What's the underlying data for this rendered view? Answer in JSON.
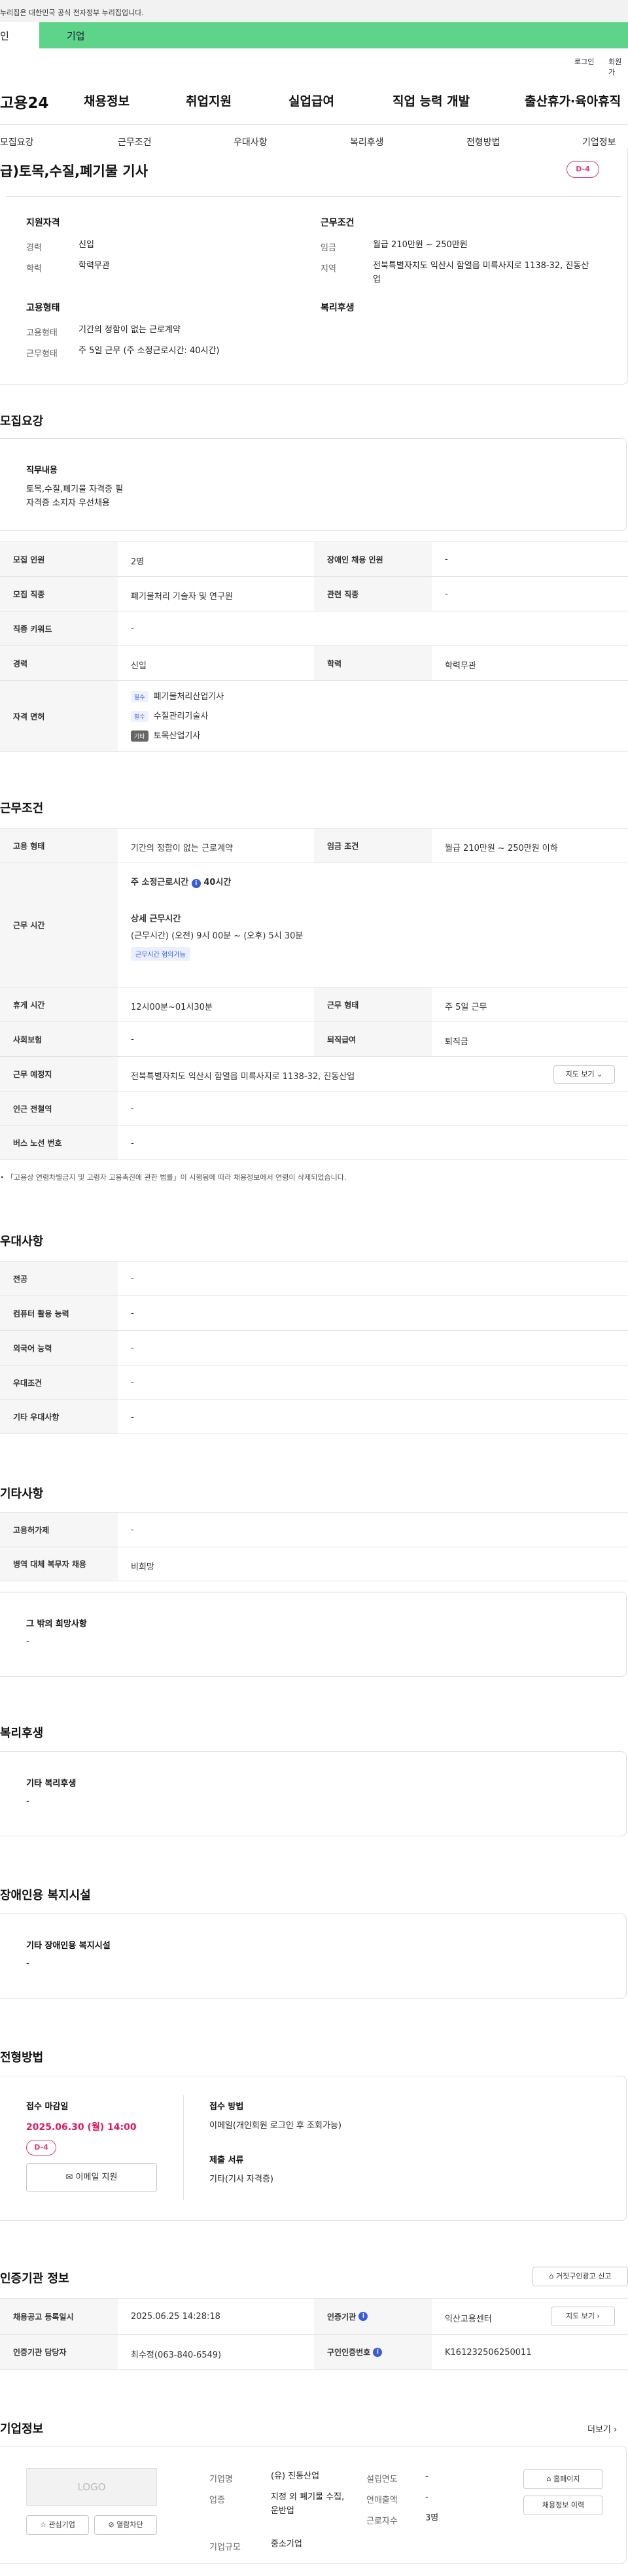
{
  "gov_bar": {
    "text": "누리집은 대한민국 공식 전자정부 누리집입니다."
  },
  "top_tabs": {
    "personal": "인",
    "company": "기업"
  },
  "util": {
    "login": "로그인",
    "signup": "회원가"
  },
  "header": {
    "logo": "고용24",
    "gnb": [
      "채용정보",
      "취업지원",
      "실업급여",
      "직업 능력 개발",
      "출산휴가·육아휴직"
    ]
  },
  "subnav": [
    "모집요강",
    "근무조건",
    "우대사항",
    "복리후생",
    "전형방법",
    "기업정보"
  ],
  "job_title": "급)토목,수질,폐기물 기사",
  "d_day": "D-4",
  "summary": {
    "qualification": {
      "heading": "지원자격",
      "career_label": "경력",
      "career": "신입",
      "edu_label": "학력",
      "edu": "학력무관"
    },
    "condition": {
      "heading": "근무조건",
      "wage_label": "임금",
      "wage": "월급 210만원 ~ 250만원",
      "loc_label": "지역",
      "loc": "전북특별자치도 익산시 함열읍 미륵사지로 1138-32, 진동산업"
    },
    "employment": {
      "heading": "고용형태",
      "type_label": "고용형태",
      "type": "기간의 정함이 없는 근로계약",
      "hours_label": "근무형태",
      "hours": "주 5일 근무 (주 소정근로시간: 40시간)"
    },
    "welfare": {
      "heading": "복리후생"
    }
  },
  "recruit": {
    "heading": "모집요강",
    "duty_label": "직무내용",
    "duty_lines": [
      "토목,수질,폐기물 자격증 필",
      "자격증 소지자 우선채용"
    ],
    "rows": {
      "count_label": "모집 인원",
      "count": "2명",
      "disabled_label": "장애인 채용 인원",
      "disabled": "-",
      "job_label": "모집 직종",
      "job": "폐기물처리 기술자 및 연구원",
      "related_label": "관련 직종",
      "related": "-",
      "keyword_label": "직종 키워드",
      "keyword": "-",
      "career_label": "경력",
      "career": "신입",
      "edu_label": "학력",
      "edu": "학력무관",
      "license_label": "자격 면허",
      "licenses": [
        {
          "badge": "필수",
          "name": "폐기물처리산업기사"
        },
        {
          "badge": "필수",
          "name": "수질관리기술사"
        },
        {
          "badge": "기타",
          "name": "토목산업기사"
        }
      ]
    }
  },
  "conditions": {
    "heading": "근무조건",
    "emp_type_label": "고용 형태",
    "emp_type": "기간의 정함이 없는 근로계약",
    "wage_label": "임금 조건",
    "wage": "월급 210만원 ~ 250만원 이하",
    "work_time_label": "근무 시간",
    "weekly_hours": "주 소정근로시간",
    "weekly_hours_value": "40시간",
    "detail_heading": "상세 근무시간",
    "detail": "(근무시간) (오전) 9시 00분 ~ (오후) 5시 30분",
    "chip": "근무시간 협의가능",
    "break_label": "휴게 시간",
    "break": "12시00분~01시30분",
    "work_form_label": "근무 형태",
    "work_form": "주 5일 근무",
    "insurance_label": "사회보험",
    "insurance": "-",
    "severance_label": "퇴직급여",
    "severance": "퇴직금",
    "location_label": "근무 예정지",
    "location": "전북특별자치도 익산시 함열읍 미륵사지로 1138-32, 진동산업",
    "map_button": "지도 보기",
    "station_label": "인근 전철역",
    "station": "-",
    "bus_label": "버스 노선 번호",
    "bus": "-",
    "note": "「고용상 연령차별금지 및 고령자 고용촉진에 관한 법률」이 시행됨에 따라 채용정보에서 연령이 삭제되었습니다."
  },
  "preference": {
    "heading": "우대사항",
    "major_label": "전공",
    "major": "-",
    "computer_label": "컴퓨터 활용 능력",
    "computer": "-",
    "language_label": "외국어 능력",
    "language": "-",
    "pref_label": "우대조건",
    "pref": "-",
    "etc_label": "기타 우대사항",
    "etc": "-"
  },
  "others": {
    "heading": "기타사항",
    "permit_label": "고용허가제",
    "permit": "-",
    "military_label": "병역 대체 복무자 채용",
    "military": "비희망",
    "wish_label": "그 밖의 희망사항",
    "wish": "-"
  },
  "welfare": {
    "heading": "복리후생",
    "label": "기타 복리후생",
    "value": "-"
  },
  "disabled_facility": {
    "heading": "장애인용 복지시설",
    "label": "기타 장애인용 복지시설",
    "value": "-"
  },
  "selection": {
    "heading": "전형방법",
    "deadline_label": "접수 마감일",
    "deadline": "2025.06.30 (월) 14:00",
    "dday": "D-4",
    "apply_button": "이메일 지원",
    "method_label": "접수 방법",
    "method": "이메일(개인회원 로그인 후 조회가능)",
    "docs_label": "제출 서류",
    "docs": "기타(기사 자격증)"
  },
  "cert": {
    "heading": "인증기관 정보",
    "report_button": "거짓구인광고 신고",
    "reg_date_label": "채용공고 등록일시",
    "reg_date": "2025.06.25 14:28:18",
    "agency_label": "인증기관",
    "agency": "익산고용센터",
    "map_button": "지도 보기",
    "manager_label": "인증기관 담당자",
    "manager": "최수정(063-840-6549)",
    "number_label": "구인인증번호",
    "number": "K161232506250011"
  },
  "company": {
    "heading": "기업정보",
    "more": "더보기",
    "logo_placeholder": "LOGO",
    "interest_button": "관심기업",
    "block_button": "열람차단",
    "name_label": "기업명",
    "name": "(유) 진동산업",
    "industry_label": "업종",
    "industry": "지정 외 폐기물 수집, 운반업",
    "scale_label": "기업규모",
    "scale": "중소기업",
    "founded_label": "설립연도",
    "founded": "-",
    "sales_label": "연매출액",
    "sales": "-",
    "employees_label": "근로자수",
    "employees": "3명",
    "homepage_button": "홈페이지",
    "history_button": "채용정보 이력"
  },
  "colors": {
    "accent_green": "#5ed38a",
    "dday_pink": "#e6397a",
    "link_blue": "#3a5bd9"
  }
}
